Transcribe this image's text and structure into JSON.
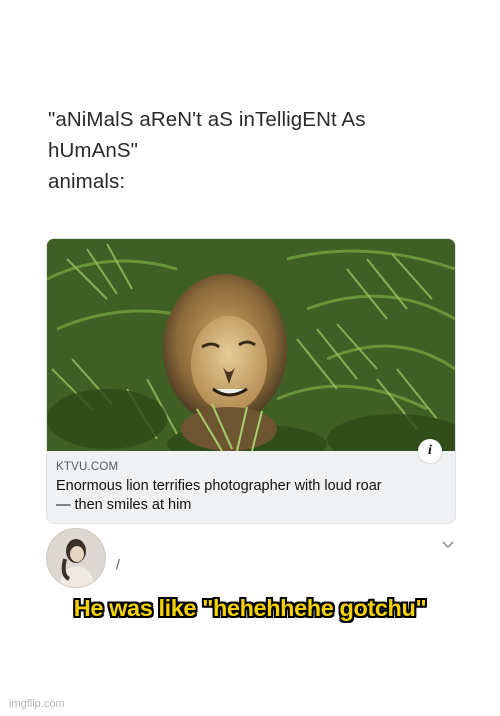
{
  "post": {
    "line1": "\"aNiMalS aReN't aS inTelligENt As",
    "line2": "hUmAnS\"",
    "line3": "animals:"
  },
  "link_card": {
    "domain": "KTVU.COM",
    "headline_line1": "Enormous lion terrifies photographer with loud roar",
    "headline_line2": "— then smiles at him",
    "info_icon": "info-icon"
  },
  "comment": {
    "avatar_icon": "avatar-photo",
    "mark": "/",
    "chevron_icon": "chevron-down-icon"
  },
  "caption": "He was like \"hehehhehe gotchu\"",
  "watermark": "imgflip.com",
  "colors": {
    "caption_fill": "#f4d200",
    "caption_outline": "#000000",
    "card_bg": "#f0f1f3"
  }
}
